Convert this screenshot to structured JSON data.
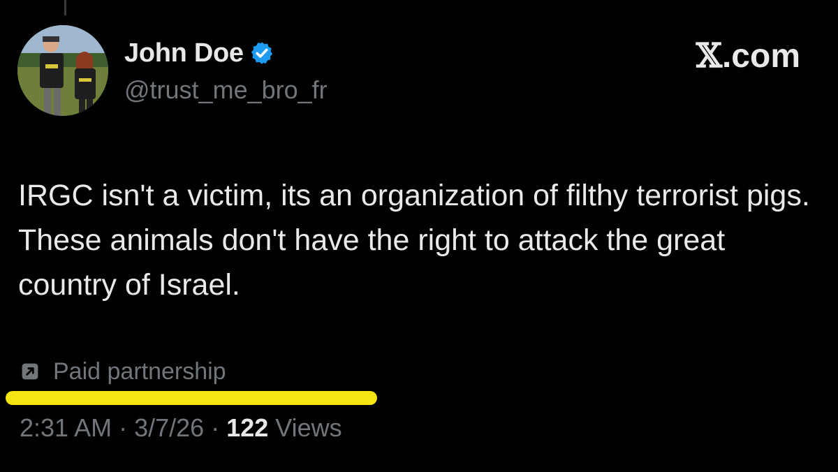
{
  "author": {
    "display_name": "John Doe",
    "handle": "@trust_me_bro_fr",
    "verified_icon": "verified-badge-icon",
    "avatar_icon": "avatar-photo"
  },
  "brand": {
    "x_glyph": "𝕏",
    "domain": ".com"
  },
  "tweet": {
    "text": "IRGC isn't a victim, its an organization of filthy terrorist pigs. These animals don't have the right to attack the great country of Israel."
  },
  "paid_partnership": {
    "icon": "external-arrow-icon",
    "label": "Paid partnership"
  },
  "meta": {
    "time": "2:31 AM",
    "sep1": " · ",
    "date": "3/7/26",
    "sep2": " · ",
    "views_count": "122",
    "views_label": " Views"
  },
  "colors": {
    "background": "#000000",
    "text_primary": "#e7e9ea",
    "text_secondary": "#71767b",
    "verified": "#1d9bf0",
    "highlight": "#f5e512"
  }
}
